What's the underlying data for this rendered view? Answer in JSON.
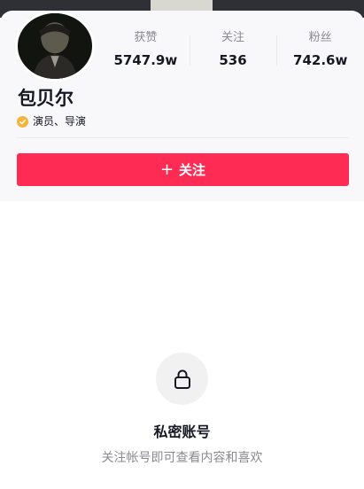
{
  "profile": {
    "name": "包贝尔",
    "verify_text": "演员、导演"
  },
  "stats": [
    {
      "label": "获赞",
      "value": "5747.9w"
    },
    {
      "label": "关注",
      "value": "536"
    },
    {
      "label": "粉丝",
      "value": "742.6w"
    }
  ],
  "follow_button": {
    "icon": "+",
    "label": "关注"
  },
  "private": {
    "title": "私密账号",
    "subtitle": "关注帐号即可查看内容和喜欢"
  },
  "colors": {
    "accent": "#fe2c55",
    "verify_badge": "#f5b53c",
    "muted_text": "#8a8b91"
  },
  "icons": {
    "verify": "verified-check-icon",
    "lock": "lock-icon",
    "plus": "plus-icon"
  }
}
